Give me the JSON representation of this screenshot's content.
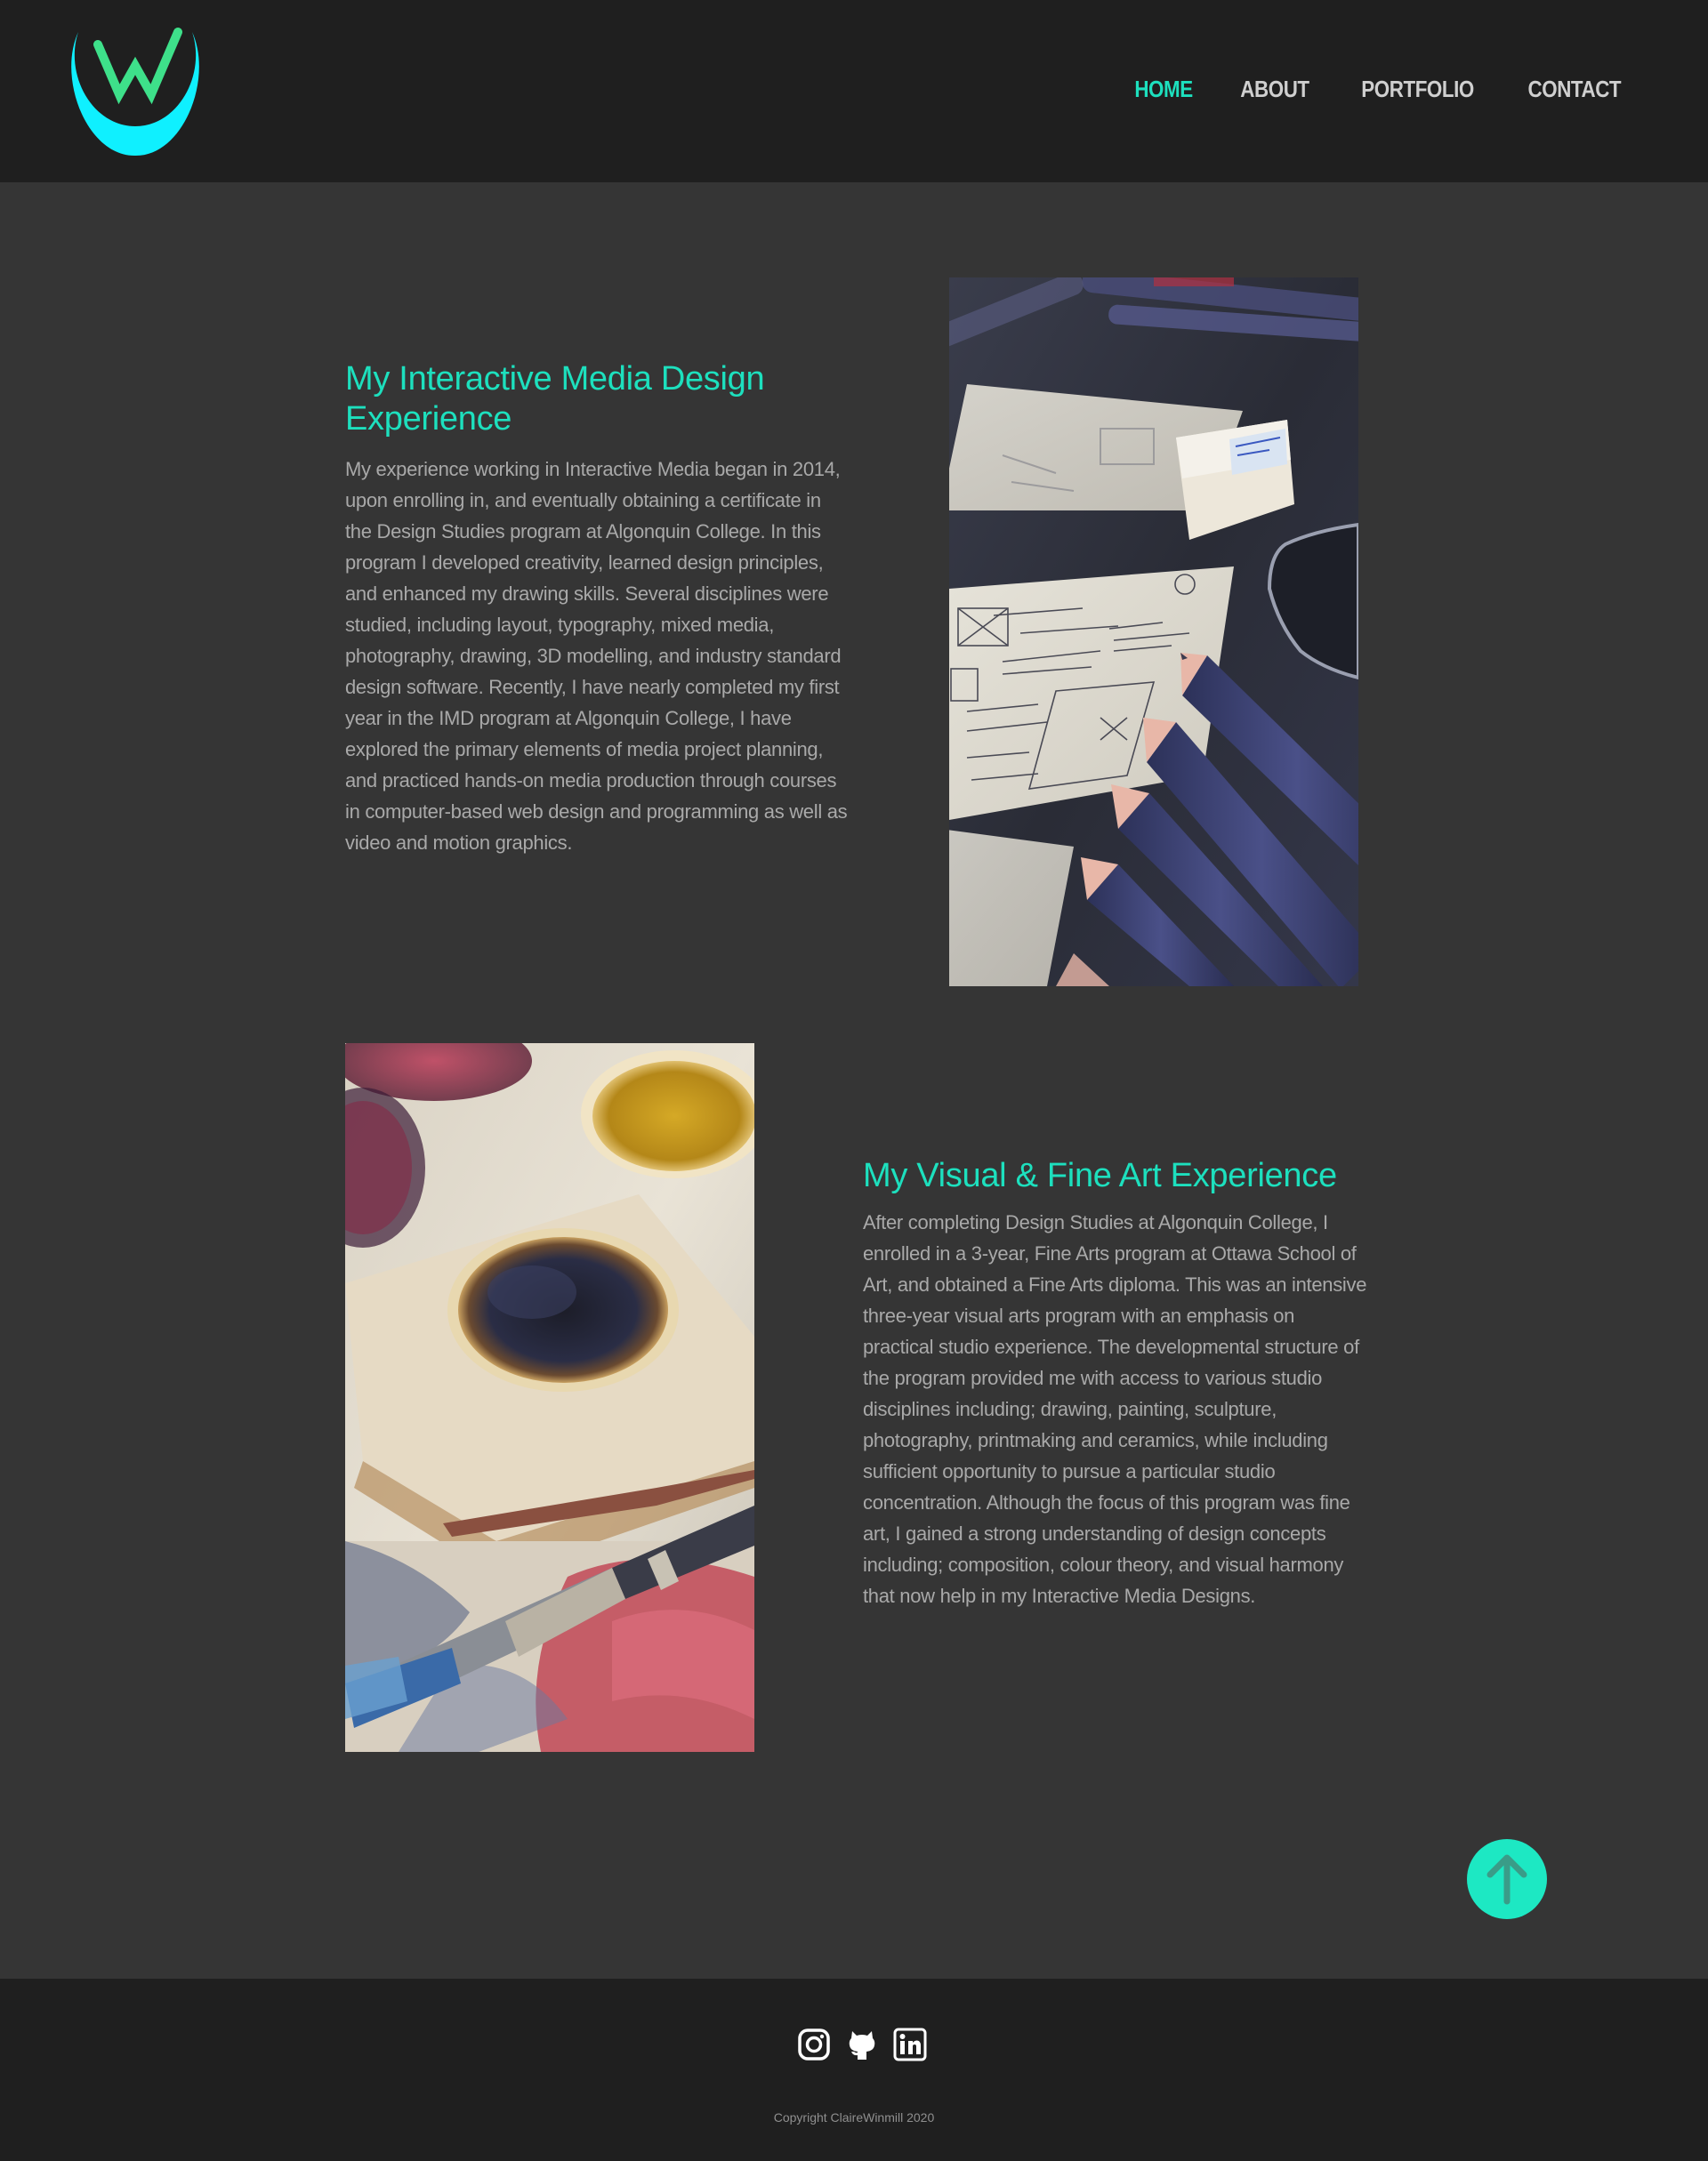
{
  "header": {
    "logo_icon": "w-crescent-logo-icon",
    "nav": [
      {
        "label": "HOME",
        "active": true
      },
      {
        "label": "ABOUT",
        "active": false
      },
      {
        "label": "PORTFOLIO",
        "active": false
      },
      {
        "label": "CONTACT",
        "active": false
      }
    ]
  },
  "sections": [
    {
      "title": "My Interactive Media Design Experience",
      "body": "My experience working in Interactive Media began in 2014, upon enrolling in, and eventually obtaining a certificate in the Design Studies program at Algonquin College. In this program I developed creativity, learned design principles, and enhanced my drawing skills. Several disciplines were studied, including layout, typography, mixed media, photography, drawing, 3D modelling, and industry standard design software. Recently, I have nearly completed my first year in the IMD program at Algonquin College,  I have explored the primary elements of media project planning, and practiced hands-on media production through courses in computer-based web design and programming as well as video and motion graphics.",
      "image": "wireframe-sketches-pencils-photo"
    },
    {
      "title": "My Visual & Fine Art Experience",
      "body": "After completing Design Studies at Algonquin College, I enrolled in a 3-year, Fine Arts program at Ottawa School of Art, and obtained a Fine Arts diploma. This  was an intensive three-year visual arts program with an emphasis on practical studio experience. The developmental structure of the program provided me with access to various studio disciplines including; drawing, painting, sculpture, photography, printmaking and ceramics, while including sufficient opportunity to pursue a particular studio concentration. Although the focus of this program was fine art, I gained a strong understanding of design concepts including; composition, colour theory,  and visual harmony that now help in my Interactive Media Designs.",
      "image": "paint-palette-brush-photo"
    }
  ],
  "back_to_top_icon": "arrow-up-icon",
  "footer": {
    "social": [
      "instagram-icon",
      "github-icon",
      "linkedin-icon"
    ],
    "copyright": "Copyright ClaireWinmill 2020"
  },
  "colors": {
    "accent": "#1de0be",
    "logo_cyan": "#0ff0ff",
    "header_bg": "#1f1f1f",
    "page_bg": "#353535",
    "body_text": "#a9a9a9"
  }
}
